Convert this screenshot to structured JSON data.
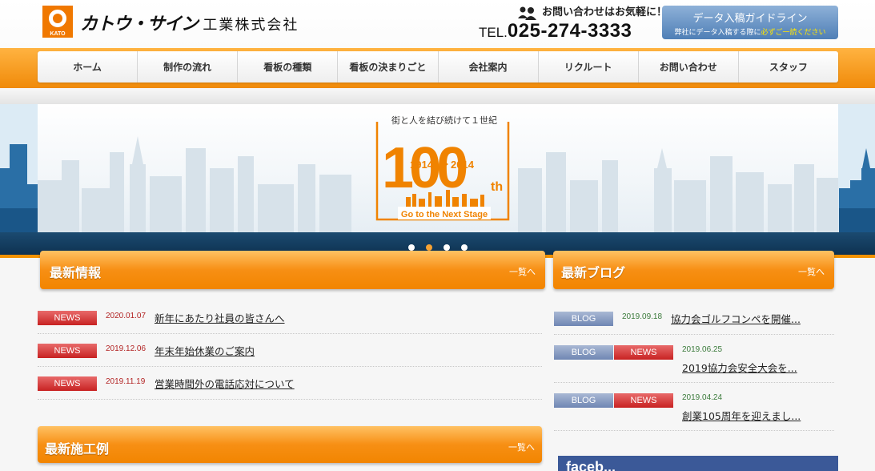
{
  "header": {
    "logo_small": "KATO",
    "logo_name": "カトウ・サイン",
    "logo_suffix": "工業株式会社",
    "contact_lead": "お問い合わせはお気軽に！",
    "tel_prefix": "TEL.",
    "tel_number": "025-274-3333",
    "guide_title": "データ入稿ガイドライン",
    "guide_note_a": "弊社にデータ入稿する際に",
    "guide_note_b": "必ずご一読ください"
  },
  "nav": {
    "items": [
      {
        "label": "ホーム"
      },
      {
        "label": "制作の流れ"
      },
      {
        "label": "看板の種類"
      },
      {
        "label": "看板の決まりごと"
      },
      {
        "label": "会社案内"
      },
      {
        "label": "リクルート"
      },
      {
        "label": "お問い合わせ"
      },
      {
        "label": "スタッフ"
      }
    ]
  },
  "hero": {
    "tagline": "街と人を結び続けて１世紀",
    "big": "100",
    "suffix": "th",
    "year_from": "1914",
    "year_to": "2014",
    "subtitle": "Go to the Next Stage",
    "slide_count": 4,
    "active_slide": 2
  },
  "news": {
    "title": "最新情報",
    "more": "一覧へ",
    "items": [
      {
        "tag": "NEWS",
        "date": "2020.01.07",
        "title": "新年にあたり社員の皆さんへ"
      },
      {
        "tag": "NEWS",
        "date": "2019.12.06",
        "title": "年末年始休業のご案内"
      },
      {
        "tag": "NEWS",
        "date": "2019.11.19",
        "title": "営業時間外の電話応対について"
      }
    ]
  },
  "blog": {
    "title": "最新ブログ",
    "more": "一覧へ",
    "items": [
      {
        "tags": [
          "BLOG"
        ],
        "date": "2019.09.18",
        "title": "協力会ゴルフコンペを開催..."
      },
      {
        "tags": [
          "BLOG",
          "NEWS"
        ],
        "date": "2019.06.25",
        "title": "2019協力会安全大会を..."
      },
      {
        "tags": [
          "BLOG",
          "NEWS"
        ],
        "date": "2019.04.24",
        "title": "創業105周年を迎えまし..."
      }
    ]
  },
  "works": {
    "title": "最新施工例",
    "more": "一覧へ"
  },
  "facebook": {
    "label": "faceb..."
  },
  "colors": {
    "brand_orange": "#f39200",
    "news_red": "#c82222",
    "blog_blue": "#6f86b3",
    "guide_blue": "#4f7fb6",
    "hero_navy": "#0e3251"
  }
}
